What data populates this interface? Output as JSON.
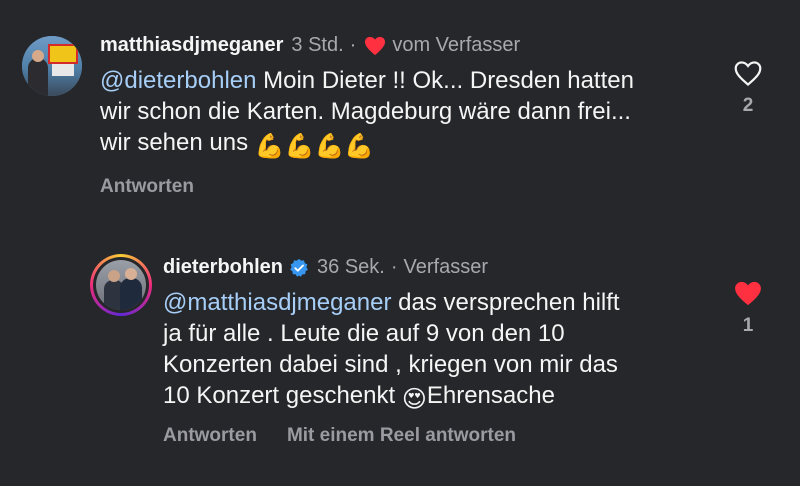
{
  "comments": [
    {
      "username": "matthiasdjmeganer",
      "time": "3 Std.",
      "dot": "·",
      "author_like_label": "vom Verfasser",
      "mention": "@dieterbohlen",
      "text_line1": " Moin Dieter !! Ok... Dresden hatten",
      "text_line2": "wir schon die Karten. Magdeburg wäre dann frei...",
      "text_line3": "wir sehen uns ",
      "emoji": "💪💪💪💪",
      "reply_label": "Antworten",
      "like_count": "2",
      "liked": false
    },
    {
      "username": "dieterbohlen",
      "time": "36 Sek.",
      "dot": "·",
      "author_label": "Verfasser",
      "mention": "@matthiasdjmeganer",
      "text_line1": " das versprechen hilft",
      "text_line2": "ja für alle . Leute die auf 9 von den 10",
      "text_line3": "Konzerten dabei sind , kriegen von mir das",
      "text_line4": "10 Konzert geschenkt ",
      "emoji": "😍",
      "text_after_emoji": "Ehrensache",
      "reply_label": "Antworten",
      "reel_reply_label": "Mit einem Reel antworten",
      "like_count": "1",
      "liked": true
    }
  ],
  "icons": {
    "heart": "heart-icon",
    "verified": "verified-badge-icon"
  },
  "colors": {
    "background": "#26272b",
    "mention": "#a6cef7",
    "like_red": "#ff3040",
    "verified_blue": "#3797f0"
  }
}
